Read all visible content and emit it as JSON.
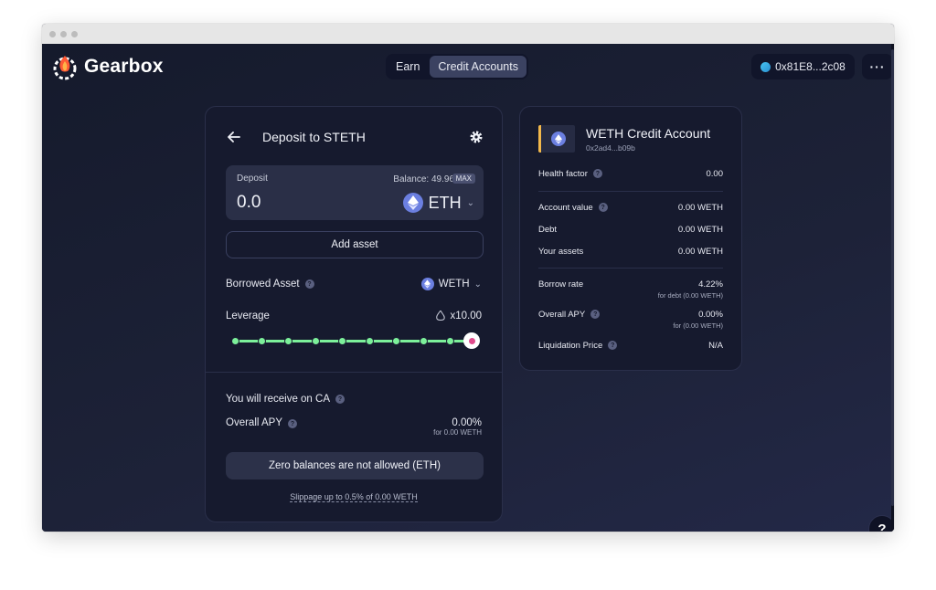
{
  "header": {
    "logo_text": "Gearbox",
    "nav": [
      "Earn",
      "Credit Accounts"
    ],
    "active_tab": "Credit Accounts",
    "wallet_address": "0x81E8...2c08",
    "more_label": "···",
    "help_label": "?"
  },
  "deposit_card": {
    "title": "Deposit to STETH",
    "deposit_label": "Deposit",
    "balance_text": "Balance: 49.96",
    "max_label": "MAX",
    "deposit_value": "0.0",
    "deposit_asset": "ETH",
    "add_asset_label": "Add asset",
    "borrowed_asset_label": "Borrowed Asset",
    "borrowed_asset_value": "WETH",
    "leverage_label": "Leverage",
    "leverage_value": "x10.00",
    "leverage_level_fraction": 1.0,
    "receive_label": "You will receive on CA",
    "overall_apy_label": "Overall APY",
    "overall_apy_value": "0.00%",
    "overall_apy_note": "for 0.00 WETH",
    "zero_balances_button": "Zero balances are not allowed (ETH)",
    "slippage_text": "Slippage up to 0.5% of 0.00 WETH"
  },
  "credit_account": {
    "title": "WETH Credit Account",
    "address": "0x2ad4...b09b",
    "health_factor_label": "Health factor",
    "health_factor_value": "0.00",
    "account_value_label": "Account value",
    "account_value": "0.00 WETH",
    "debt_label": "Debt",
    "debt_value": "0.00 WETH",
    "your_assets_label": "Your assets",
    "your_assets_value": "0.00 WETH",
    "borrow_rate_label": "Borrow rate",
    "borrow_rate_value": "4.22%",
    "borrow_rate_note": "for debt (0.00 WETH)",
    "overall_apy_label": "Overall APY",
    "overall_apy_value": "0.00%",
    "overall_apy_note": "for (0.00 WETH)",
    "liquidation_label": "Liquidation Price",
    "liquidation_value": "N/A"
  },
  "colors": {
    "accent_green": "#7cf09a",
    "eth_blue": "#6b7fe0",
    "handle_pink": "#e04a8c",
    "ca_accent": "#f2b84b"
  }
}
